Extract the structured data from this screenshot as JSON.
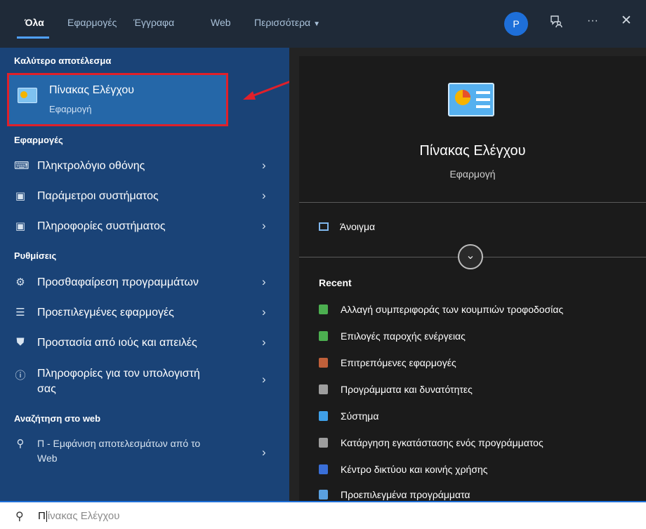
{
  "tabs": [
    {
      "label": "Όλα",
      "active": true
    },
    {
      "label": "Εφαρμογές"
    },
    {
      "label": "Έγγραφα"
    },
    {
      "label": "Web"
    },
    {
      "label": "Περισσότερα"
    }
  ],
  "header": {
    "avatar_letter": "P",
    "more_label": "···",
    "close_label": "✕"
  },
  "best_match": {
    "heading": "Καλύτερο αποτέλεσμα",
    "title": "Πίνακας Ελέγχου",
    "subtitle": "Εφαρμογή"
  },
  "apps": {
    "heading": "Εφαρμογές",
    "items": [
      {
        "label": "Πληκτρολόγιο οθόνης"
      },
      {
        "label": "Παράμετροι συστήματος"
      },
      {
        "label": "Πληροφορίες συστήματος"
      }
    ]
  },
  "settings": {
    "heading": "Ρυθμίσεις",
    "items": [
      {
        "label": "Προσθαφαίρεση προγραμμάτων"
      },
      {
        "label": "Προεπιλεγμένες εφαρμογές"
      },
      {
        "label": "Προστασία από ιούς και απειλές"
      },
      {
        "label_line1": "Πληροφορίες για τον υπολογιστή",
        "label_line2": "σας"
      }
    ]
  },
  "web": {
    "heading": "Αναζήτηση στο web",
    "line1": "Π - Εμφάνιση αποτελεσμάτων από το",
    "line2": "Web"
  },
  "detail": {
    "title": "Πίνακας Ελέγχου",
    "subtitle": "Εφαρμογή",
    "open_label": "Άνοιγμα",
    "recent_heading": "Recent",
    "recent": [
      {
        "label": "Αλλαγή συμπεριφοράς των κουμπιών τροφοδοσίας",
        "color": "#4caf50"
      },
      {
        "label": "Επιλογές παροχής ενέργειας",
        "color": "#4caf50"
      },
      {
        "label": "Επιτρεπόμενες εφαρμογές",
        "color": "#c0603a"
      },
      {
        "label": "Προγράμματα και δυνατότητες",
        "color": "#9e9e9e"
      },
      {
        "label": "Σύστημα",
        "color": "#3fa0e8"
      },
      {
        "label": "Κατάργηση εγκατάστασης ενός προγράμματος",
        "color": "#9e9e9e"
      },
      {
        "label": "Κέντρο δικτύου και κοινής χρήσης",
        "color": "#3a6fd8"
      },
      {
        "label": "Προεπιλεγμένα προγράμματα",
        "color": "#5aa0e0"
      }
    ]
  },
  "search": {
    "typed": "Π",
    "ghost": "ίνακας Ελέγχου"
  },
  "colors": {
    "accent": "#1e6fd9",
    "highlight_border": "#e0202a",
    "arrow": "#e0202a"
  }
}
